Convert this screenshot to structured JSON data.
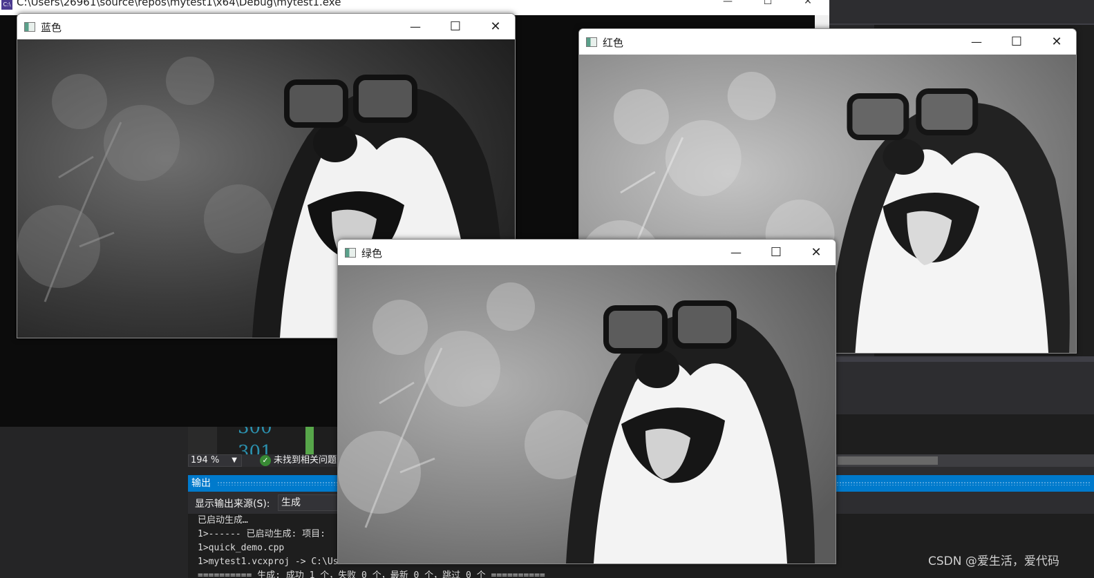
{
  "console": {
    "title": "C:\\Users\\26961\\source\\repos\\mytest1\\x64\\Debug\\mytest1.exe",
    "icon_name": "console-app-icon"
  },
  "windows": [
    {
      "title": "蓝色",
      "tone": "#7b7b7b"
    },
    {
      "title": "红色",
      "tone": "#a6a6a6"
    },
    {
      "title": "绿色",
      "tone": "#969696"
    }
  ],
  "editor": {
    "line_numbers": [
      "300",
      "301"
    ],
    "zoom": "194 %",
    "issues_status": "未找到相关问题"
  },
  "output_panel": {
    "title": "输出",
    "source_label": "显示输出来源(S):",
    "source_value": "生成",
    "lines": [
      "已启动生成…",
      "1>------ 已启动生成: 项目:",
      "1>quick_demo.cpp",
      "1>mytest1.vcxproj -> C:\\Us",
      "========== 生成: 成功 1 个，失败 0 个，最新 0 个，跳过 0 个 =========="
    ]
  },
  "watermark": "CSDN @爱生活，爱代码",
  "window_controls": {
    "minimize": "—",
    "maximize": "☐",
    "close": "✕"
  }
}
